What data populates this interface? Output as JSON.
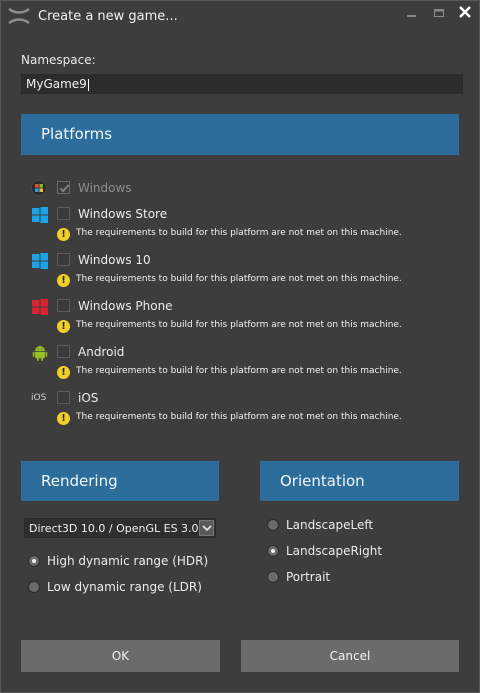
{
  "window": {
    "title": "Create a new game..."
  },
  "namespace": {
    "label": "Namespace:",
    "value": "MyGame9"
  },
  "platforms": {
    "header": "Platforms",
    "warning_text": "The requirements to build for this platform are not met on this machine.",
    "items": [
      {
        "label": "Windows",
        "icon": "windows-flag-icon",
        "checked": true,
        "disabled": true
      },
      {
        "label": "Windows Store",
        "icon": "windows-logo-icon",
        "checked": false
      },
      {
        "label": "Windows 10",
        "icon": "windows-logo-icon",
        "checked": false
      },
      {
        "label": "Windows Phone",
        "icon": "windows-phone-logo-icon",
        "checked": false
      },
      {
        "label": "Android",
        "icon": "android-icon",
        "checked": false
      },
      {
        "label": "iOS",
        "icon": "ios-text-icon",
        "icon_text": "iOS",
        "checked": false
      }
    ]
  },
  "rendering": {
    "header": "Rendering",
    "api_selected": "Direct3D 10.0 / OpenGL ES 3.0",
    "options": [
      {
        "label": "High dynamic range (HDR)",
        "selected": true
      },
      {
        "label": "Low dynamic range (LDR)",
        "selected": false
      }
    ]
  },
  "orientation": {
    "header": "Orientation",
    "options": [
      {
        "label": "LandscapeLeft",
        "selected": false
      },
      {
        "label": "LandscapeRight",
        "selected": true
      },
      {
        "label": "Portrait",
        "selected": false
      }
    ]
  },
  "buttons": {
    "ok": "OK",
    "cancel": "Cancel"
  },
  "colors": {
    "accent": "#2d6d9c",
    "warning": "#f1cf2b",
    "windows_blue": "#1aa3e8",
    "windows_phone_red": "#d9252f",
    "android_green": "#97c024"
  }
}
